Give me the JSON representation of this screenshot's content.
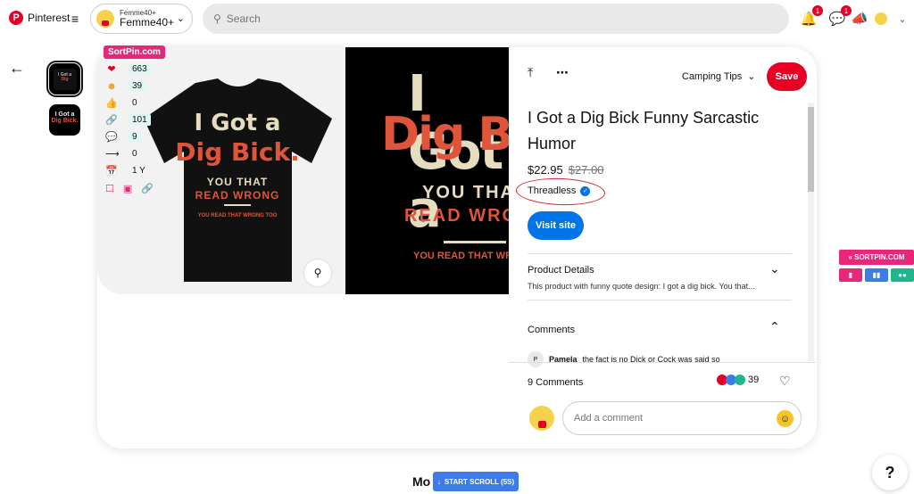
{
  "header": {
    "brand": "Pinterest",
    "account_small": "Femme40+",
    "account_name": "Femme40+",
    "search_placeholder": "Search",
    "notif_count": "1",
    "msg_count": "1"
  },
  "sortpin": {
    "label": "SortPin.com",
    "stats": [
      {
        "icon": "heart-icon",
        "value": "663"
      },
      {
        "icon": "smile-icon",
        "value": "39"
      },
      {
        "icon": "thumbs-up-icon",
        "value": "0"
      },
      {
        "icon": "link-icon",
        "value": "101"
      },
      {
        "icon": "comment-icon",
        "value": "9"
      },
      {
        "icon": "share-icon",
        "value": "0"
      },
      {
        "icon": "calendar-icon",
        "value": "1 Y"
      }
    ]
  },
  "shirt_text": {
    "line1": "I Got a",
    "line2": "Dig Bick.",
    "line3": "YOU THAT",
    "line4": "READ WRONG",
    "line5": "YOU READ THAT WRONG TOO"
  },
  "thumb_text": {
    "line1": "I Got a",
    "line2": "Dig Bick."
  },
  "pin": {
    "board": "Camping Tips",
    "save_label": "Save",
    "title": "I Got a Dig Bick Funny Sarcastic Humor",
    "price": "$22.95",
    "old_price": "$27.00",
    "seller": "Threadless",
    "visit_label": "Visit site",
    "details_title": "Product Details",
    "details_text": "This product with funny quote design: I got a dig bick. You that...",
    "comments_title": "Comments",
    "first_comment_initial": "P",
    "first_comment_author": "Pamela",
    "first_comment_text": "the fact is no Dick or Cock was said so",
    "comment_count_label": "9 Comments",
    "reaction_count": "39",
    "add_comment_placeholder": "Add a comment"
  },
  "sidebox": {
    "title": "SORTPIN.COM"
  },
  "bottom": {
    "more_label": "Mo",
    "scroll_label": "START SCROLL (5S)",
    "help_label": "?"
  },
  "colors": {
    "pinterest_red": "#e60023",
    "sortpin_pink": "#e6277a",
    "visit_blue": "#0074e8",
    "shirt_cream": "#e6dcc0",
    "shirt_orange": "#e0553a"
  }
}
